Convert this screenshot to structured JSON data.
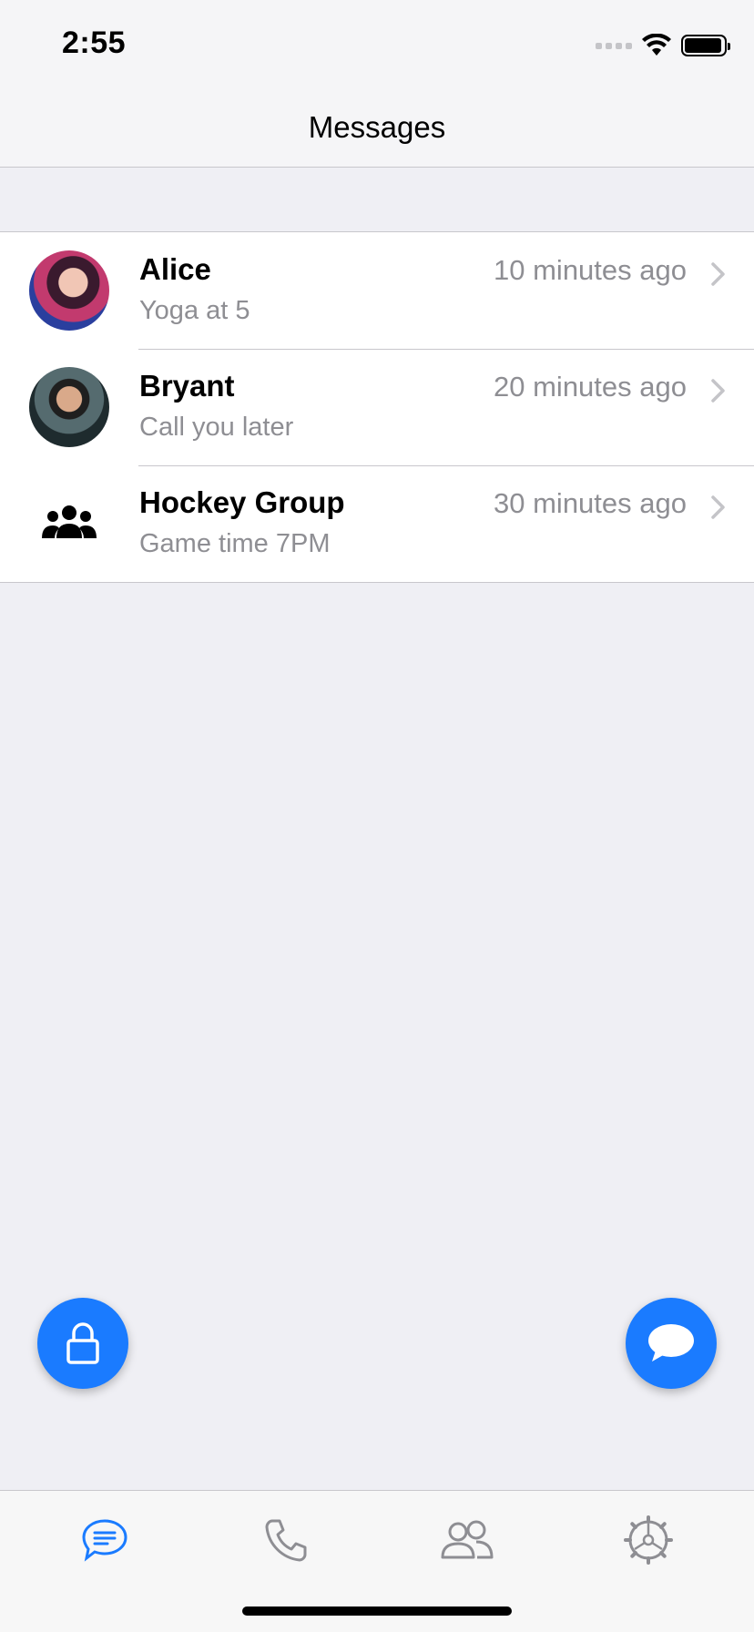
{
  "status_bar": {
    "time": "2:55"
  },
  "nav": {
    "title": "Messages"
  },
  "conversations": [
    {
      "name": "Alice",
      "message": "Yoga at 5",
      "time": "10 minutes ago",
      "avatar": "alice-photo"
    },
    {
      "name": "Bryant",
      "message": "Call you later",
      "time": "20 minutes ago",
      "avatar": "bryant-photo"
    },
    {
      "name": "Hockey Group",
      "message": "Game time 7PM",
      "time": "30 minutes ago",
      "avatar": "group-icon"
    }
  ],
  "fabs": {
    "left_icon": "lock-icon",
    "right_icon": "chat-bubble-icon"
  },
  "tabs": [
    {
      "icon": "messages-icon",
      "active": true
    },
    {
      "icon": "phone-icon",
      "active": false
    },
    {
      "icon": "contacts-icon",
      "active": false
    },
    {
      "icon": "settings-icon",
      "active": false
    }
  ],
  "colors": {
    "accent": "#1a7bff",
    "secondary_text": "#8e8e93",
    "background": "#efeff4",
    "inactive_icon": "#8e8e93"
  }
}
